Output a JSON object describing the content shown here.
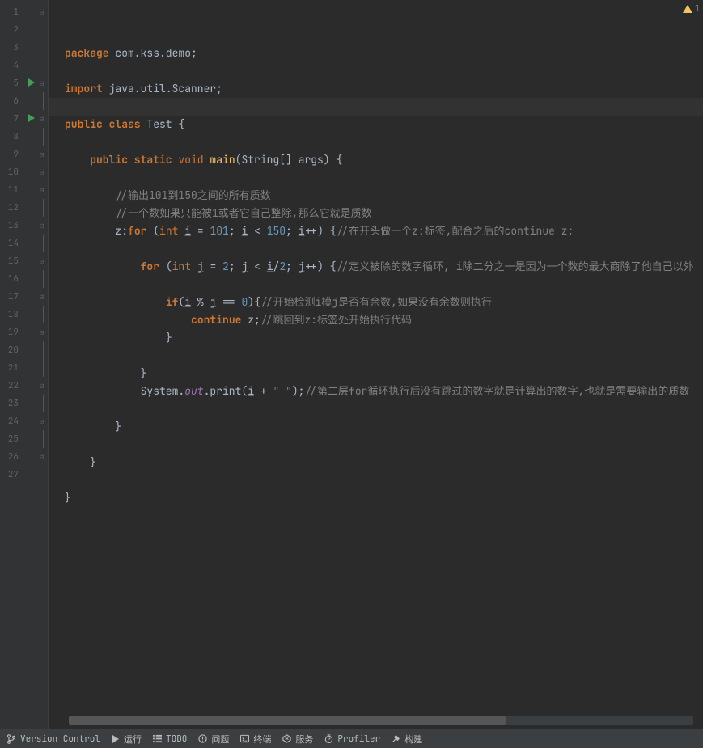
{
  "warning_count": "1",
  "lines": [
    {
      "n": 1,
      "run": false,
      "fold": "o",
      "html": [
        {
          "c": "kw-bold",
          "t": "package "
        },
        {
          "c": "id",
          "t": "com.kss.demo"
        },
        {
          "c": "op",
          "t": ";"
        }
      ]
    },
    {
      "n": 2,
      "run": false,
      "fold": "",
      "html": []
    },
    {
      "n": 3,
      "run": false,
      "fold": "",
      "html": [
        {
          "c": "kw-bold",
          "t": "import "
        },
        {
          "c": "id",
          "t": "java.util.Scanner"
        },
        {
          "c": "op",
          "t": ";"
        }
      ]
    },
    {
      "n": 4,
      "run": false,
      "fold": "",
      "hl": true,
      "html": []
    },
    {
      "n": 5,
      "run": true,
      "fold": "o",
      "html": [
        {
          "c": "kw-bold",
          "t": "public class "
        },
        {
          "c": "cls",
          "t": "Test "
        },
        {
          "c": "op",
          "t": "{"
        }
      ]
    },
    {
      "n": 6,
      "run": false,
      "fold": "l",
      "html": []
    },
    {
      "n": 7,
      "run": true,
      "fold": "o",
      "html": [
        {
          "c": "id",
          "t": "    "
        },
        {
          "c": "kw-bold",
          "t": "public static "
        },
        {
          "c": "kw",
          "t": "void "
        },
        {
          "c": "fn",
          "t": "main"
        },
        {
          "c": "op",
          "t": "("
        },
        {
          "c": "id",
          "t": "String[] "
        },
        {
          "c": "id",
          "t": "args"
        },
        {
          "c": "op",
          "t": ") {"
        }
      ]
    },
    {
      "n": 8,
      "run": false,
      "fold": "l",
      "html": []
    },
    {
      "n": 9,
      "run": false,
      "fold": "o",
      "html": [
        {
          "c": "id",
          "t": "        "
        },
        {
          "c": "cmt",
          "t": "//输出101到150之间的所有质数"
        }
      ]
    },
    {
      "n": 10,
      "run": false,
      "fold": "c",
      "html": [
        {
          "c": "id",
          "t": "        "
        },
        {
          "c": "cmt",
          "t": "//一个数如果只能被1或者它自己整除,那么它就是质数"
        }
      ]
    },
    {
      "n": 11,
      "run": false,
      "fold": "o",
      "html": [
        {
          "c": "id",
          "t": "        z:"
        },
        {
          "c": "kw-bold",
          "t": "for "
        },
        {
          "c": "op",
          "t": "("
        },
        {
          "c": "kw",
          "t": "int "
        },
        {
          "c": "var",
          "t": "i"
        },
        {
          "c": "op",
          "t": " = "
        },
        {
          "c": "num",
          "t": "101"
        },
        {
          "c": "op",
          "t": "; "
        },
        {
          "c": "var",
          "t": "i"
        },
        {
          "c": "op",
          "t": " < "
        },
        {
          "c": "num",
          "t": "150"
        },
        {
          "c": "op",
          "t": "; "
        },
        {
          "c": "var",
          "t": "i"
        },
        {
          "c": "op",
          "t": "++) {"
        },
        {
          "c": "cmt",
          "t": "//在开头做一个z:标签,配合之后的continue z;"
        }
      ]
    },
    {
      "n": 12,
      "run": false,
      "fold": "l",
      "html": []
    },
    {
      "n": 13,
      "run": false,
      "fold": "o",
      "html": [
        {
          "c": "id",
          "t": "            "
        },
        {
          "c": "kw-bold",
          "t": "for "
        },
        {
          "c": "op",
          "t": "("
        },
        {
          "c": "kw",
          "t": "int "
        },
        {
          "c": "var",
          "t": "j"
        },
        {
          "c": "op",
          "t": " = "
        },
        {
          "c": "num",
          "t": "2"
        },
        {
          "c": "op",
          "t": "; "
        },
        {
          "c": "var",
          "t": "j"
        },
        {
          "c": "op",
          "t": " < "
        },
        {
          "c": "var",
          "t": "i"
        },
        {
          "c": "op",
          "t": "/"
        },
        {
          "c": "num",
          "t": "2"
        },
        {
          "c": "op",
          "t": "; "
        },
        {
          "c": "var",
          "t": "j"
        },
        {
          "c": "op",
          "t": "++) {"
        },
        {
          "c": "cmt",
          "t": "//定义被除的数字循环, i除二分之一是因为一个数的最大商除了他自己以外"
        }
      ]
    },
    {
      "n": 14,
      "run": false,
      "fold": "l",
      "html": []
    },
    {
      "n": 15,
      "run": false,
      "fold": "o",
      "html": [
        {
          "c": "id",
          "t": "                "
        },
        {
          "c": "kw-bold",
          "t": "if"
        },
        {
          "c": "op",
          "t": "("
        },
        {
          "c": "var",
          "t": "i"
        },
        {
          "c": "op",
          "t": " % "
        },
        {
          "c": "var",
          "t": "j"
        },
        {
          "c": "op",
          "t": " == "
        },
        {
          "c": "num",
          "t": "0"
        },
        {
          "c": "op",
          "t": "){"
        },
        {
          "c": "cmt",
          "t": "//开始检测i模j是否有余数,如果没有余数则执行"
        }
      ]
    },
    {
      "n": 16,
      "run": false,
      "fold": "l",
      "html": [
        {
          "c": "id",
          "t": "                    "
        },
        {
          "c": "kw-bold",
          "t": "continue "
        },
        {
          "c": "id",
          "t": "z"
        },
        {
          "c": "op",
          "t": ";"
        },
        {
          "c": "cmt",
          "t": "//跳回到z:标签处开始执行代码"
        }
      ]
    },
    {
      "n": 17,
      "run": false,
      "fold": "c",
      "html": [
        {
          "c": "id",
          "t": "                "
        },
        {
          "c": "op",
          "t": "}"
        }
      ]
    },
    {
      "n": 18,
      "run": false,
      "fold": "l",
      "html": []
    },
    {
      "n": 19,
      "run": false,
      "fold": "c",
      "html": [
        {
          "c": "id",
          "t": "            "
        },
        {
          "c": "op",
          "t": "}"
        }
      ]
    },
    {
      "n": 20,
      "run": false,
      "fold": "l",
      "html": [
        {
          "c": "id",
          "t": "            System."
        },
        {
          "c": "static-field",
          "t": "out"
        },
        {
          "c": "id",
          "t": ".print("
        },
        {
          "c": "var",
          "t": "i"
        },
        {
          "c": "op",
          "t": " + "
        },
        {
          "c": "str",
          "t": "\" \""
        },
        {
          "c": "op",
          "t": ");"
        },
        {
          "c": "cmt",
          "t": "//第二层for循环执行后没有跳过的数字就是计算出的数字,也就是需要输出的质数"
        }
      ]
    },
    {
      "n": 21,
      "run": false,
      "fold": "l",
      "html": []
    },
    {
      "n": 22,
      "run": false,
      "fold": "c",
      "html": [
        {
          "c": "id",
          "t": "        "
        },
        {
          "c": "op",
          "t": "}"
        }
      ]
    },
    {
      "n": 23,
      "run": false,
      "fold": "l",
      "html": []
    },
    {
      "n": 24,
      "run": false,
      "fold": "c",
      "html": [
        {
          "c": "id",
          "t": "    "
        },
        {
          "c": "op",
          "t": "}"
        }
      ]
    },
    {
      "n": 25,
      "run": false,
      "fold": "l",
      "html": []
    },
    {
      "n": 26,
      "run": false,
      "fold": "c",
      "html": [
        {
          "c": "op",
          "t": "}"
        }
      ]
    },
    {
      "n": 27,
      "run": false,
      "fold": "",
      "html": []
    }
  ],
  "bottom": {
    "version_control": "Version Control",
    "run": "运行",
    "todo": "TODO",
    "problems": "问题",
    "terminal": "终端",
    "services": "服务",
    "profiler": "Profiler",
    "build": "构建"
  }
}
